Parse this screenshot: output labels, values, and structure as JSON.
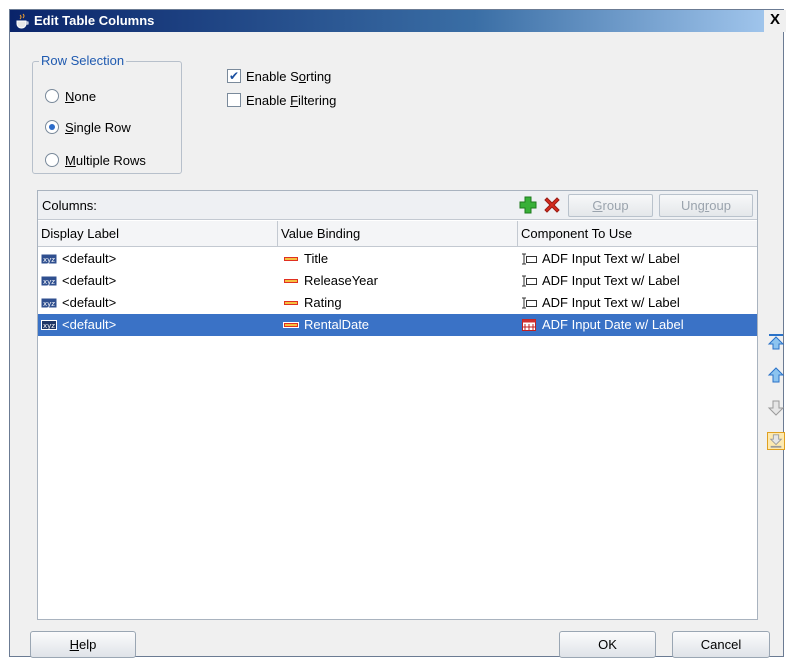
{
  "window": {
    "title": "Edit Table Columns",
    "close_label": "X"
  },
  "row_selection": {
    "legend": "Row Selection",
    "options": [
      {
        "pre": "",
        "mnemonic": "N",
        "post": "one",
        "checked": false
      },
      {
        "pre": "",
        "mnemonic": "S",
        "post": "ingle Row",
        "checked": true
      },
      {
        "pre": "",
        "mnemonic": "M",
        "post": "ultiple Rows",
        "checked": false
      }
    ]
  },
  "options": {
    "sorting": {
      "pre": "Enable S",
      "mnemonic": "o",
      "post": "rting",
      "checked": true
    },
    "filtering": {
      "pre": "Enable ",
      "mnemonic": "F",
      "post": "iltering",
      "checked": false
    }
  },
  "columns_panel": {
    "title": "Columns:",
    "add_icon": "plus-icon",
    "remove_icon": "delete-x-icon",
    "group_button": {
      "pre": "",
      "mnemonic": "G",
      "post": "roup"
    },
    "ungroup_button": {
      "pre": "Ung",
      "mnemonic": "r",
      "post": "oup"
    },
    "headers": [
      "Display Label",
      "Value Binding",
      "Component To Use"
    ],
    "rows": [
      {
        "label": "<default>",
        "binding": "Title",
        "component": "ADF Input Text w/ Label",
        "component_icon": "input-text-icon",
        "selected": false
      },
      {
        "label": "<default>",
        "binding": "ReleaseYear",
        "component": "ADF Input Text w/ Label",
        "component_icon": "input-text-icon",
        "selected": false
      },
      {
        "label": "<default>",
        "binding": "Rating",
        "component": "ADF Input Text w/ Label",
        "component_icon": "input-text-icon",
        "selected": false
      },
      {
        "label": "<default>",
        "binding": "RentalDate",
        "component": "ADF Input Date w/ Label",
        "component_icon": "input-date-icon",
        "selected": true
      }
    ]
  },
  "side_buttons": [
    "move-to-top-icon",
    "move-up-icon",
    "move-down-icon",
    "move-to-bottom-icon"
  ],
  "footer": {
    "help": {
      "pre": "",
      "mnemonic": "H",
      "post": "elp"
    },
    "ok": "OK",
    "cancel": "Cancel"
  },
  "colors": {
    "title_bar": "#0a246a",
    "selection": "#3a72c6",
    "legend_text": "#1f5ab0",
    "add_icon": "#2fa52f",
    "remove_icon": "#d62b1f"
  }
}
